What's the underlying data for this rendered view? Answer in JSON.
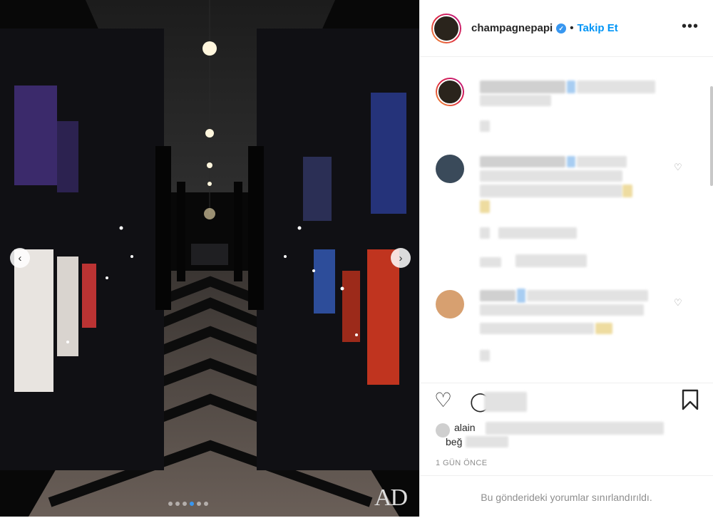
{
  "post": {
    "username": "champagnepapi",
    "bullet": "•",
    "follow_label": "Takip Et",
    "more_icon": "more-horizontal-icon",
    "verified_icon": "verified-badge-icon"
  },
  "media": {
    "prev_icon": "chevron-left-icon",
    "next_icon": "chevron-right-icon",
    "watermark": "AD",
    "carousel_count": 6,
    "carousel_active_index": 3
  },
  "likes": {
    "prefix": "alain",
    "suffix": "beğ"
  },
  "meta": {
    "time": "1 GÜN ÖNCE",
    "restricted_text": "Bu gönderideki yorumlar sınırlandırıldı."
  },
  "colors": {
    "accent": "#0095f6",
    "verified": "#3897f0"
  }
}
